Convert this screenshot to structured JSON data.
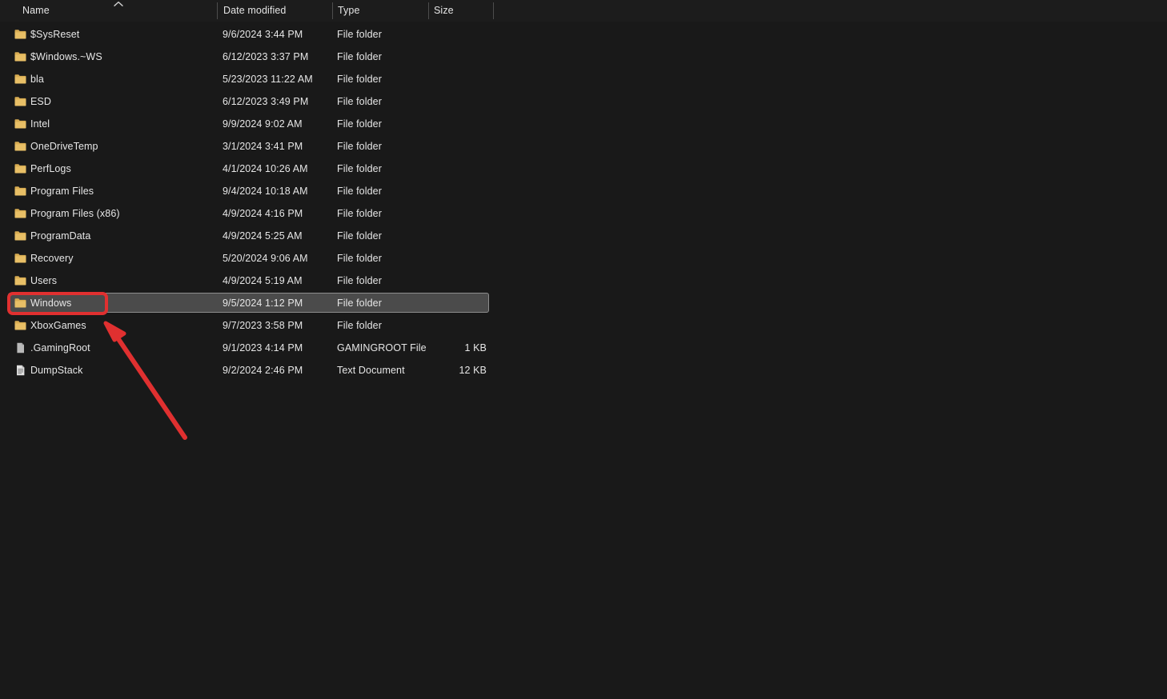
{
  "window": {
    "background_color": "#191919",
    "accent_color": "#e03030",
    "selection_color": "#4b4b4b"
  },
  "columns": {
    "name": "Name",
    "date_modified": "Date modified",
    "type": "Type",
    "size": "Size",
    "sort": {
      "column": "Name",
      "direction": "ascending",
      "icon": "chevron-up-icon"
    }
  },
  "files": [
    {
      "name": "$SysReset",
      "date": "9/6/2024 3:44 PM",
      "type": "File folder",
      "size": "",
      "icon": "folder-icon",
      "selected": false
    },
    {
      "name": "$Windows.~WS",
      "date": "6/12/2023 3:37 PM",
      "type": "File folder",
      "size": "",
      "icon": "folder-icon",
      "selected": false
    },
    {
      "name": "bla",
      "date": "5/23/2023 11:22 AM",
      "type": "File folder",
      "size": "",
      "icon": "folder-icon",
      "selected": false
    },
    {
      "name": "ESD",
      "date": "6/12/2023 3:49 PM",
      "type": "File folder",
      "size": "",
      "icon": "folder-icon",
      "selected": false
    },
    {
      "name": "Intel",
      "date": "9/9/2024 9:02 AM",
      "type": "File folder",
      "size": "",
      "icon": "folder-icon",
      "selected": false
    },
    {
      "name": "OneDriveTemp",
      "date": "3/1/2024 3:41 PM",
      "type": "File folder",
      "size": "",
      "icon": "folder-icon",
      "selected": false
    },
    {
      "name": "PerfLogs",
      "date": "4/1/2024 10:26 AM",
      "type": "File folder",
      "size": "",
      "icon": "folder-icon",
      "selected": false
    },
    {
      "name": "Program Files",
      "date": "9/4/2024 10:18 AM",
      "type": "File folder",
      "size": "",
      "icon": "folder-icon",
      "selected": false
    },
    {
      "name": "Program Files (x86)",
      "date": "4/9/2024 4:16 PM",
      "type": "File folder",
      "size": "",
      "icon": "folder-icon",
      "selected": false
    },
    {
      "name": "ProgramData",
      "date": "4/9/2024 5:25 AM",
      "type": "File folder",
      "size": "",
      "icon": "folder-icon",
      "selected": false
    },
    {
      "name": "Recovery",
      "date": "5/20/2024 9:06 AM",
      "type": "File folder",
      "size": "",
      "icon": "folder-icon",
      "selected": false
    },
    {
      "name": "Users",
      "date": "4/9/2024 5:19 AM",
      "type": "File folder",
      "size": "",
      "icon": "folder-icon",
      "selected": false
    },
    {
      "name": "Windows",
      "date": "9/5/2024 1:12 PM",
      "type": "File folder",
      "size": "",
      "icon": "folder-icon",
      "selected": true
    },
    {
      "name": "XboxGames",
      "date": "9/7/2023 3:58 PM",
      "type": "File folder",
      "size": "",
      "icon": "folder-icon",
      "selected": false
    },
    {
      "name": ".GamingRoot",
      "date": "9/1/2023 4:14 PM",
      "type": "GAMINGROOT File",
      "size": "1 KB",
      "icon": "generic-file-icon",
      "selected": false
    },
    {
      "name": "DumpStack",
      "date": "9/2/2024 2:46 PM",
      "type": "Text Document",
      "size": "12 KB",
      "icon": "text-document-icon",
      "selected": false
    }
  ],
  "annotations": {
    "highlight": {
      "target": "Windows",
      "shape": "rectangle",
      "color": "#e03030"
    },
    "arrow": {
      "points_to": "Windows",
      "color": "#e03030",
      "direction": "up-left"
    }
  }
}
